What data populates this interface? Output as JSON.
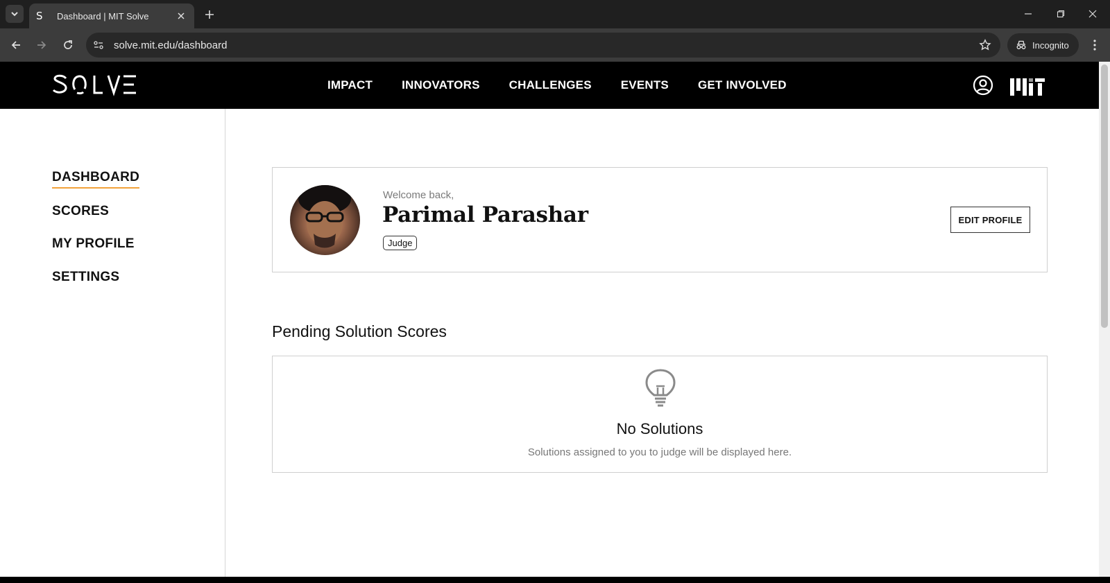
{
  "browser": {
    "tab_title": "Dashboard | MIT Solve",
    "tab_favicon_glyph": "S",
    "url": "solve.mit.edu/dashboard",
    "incognito_label": "Incognito",
    "icons": [
      "tab-search-icon",
      "close-icon",
      "plus-icon",
      "minimize-icon",
      "restore-icon",
      "close-window-icon",
      "back-arrow-icon",
      "forward-arrow-icon",
      "reload-icon",
      "site-info-icon",
      "star-icon",
      "incognito-icon",
      "more-vert-icon"
    ]
  },
  "header": {
    "logo_alt": "SOLVE",
    "nav": [
      "IMPACT",
      "INNOVATORS",
      "CHALLENGES",
      "EVENTS",
      "GET INVOLVED"
    ],
    "icons": [
      "user-circle-icon",
      "mit-logo"
    ]
  },
  "sidebar": {
    "items": [
      "DASHBOARD",
      "SCORES",
      "MY PROFILE",
      "SETTINGS"
    ],
    "active": "DASHBOARD",
    "accent_color": "#f2a23a"
  },
  "profile": {
    "greeting": "Welcome back,",
    "name": "Parimal Parashar",
    "role": "Judge",
    "edit_button": "EDIT PROFILE"
  },
  "pending": {
    "title": "Pending Solution Scores",
    "empty_icon": "lightbulb-icon",
    "empty_title": "No Solutions",
    "empty_desc": "Solutions assigned to you to judge will be displayed here."
  }
}
